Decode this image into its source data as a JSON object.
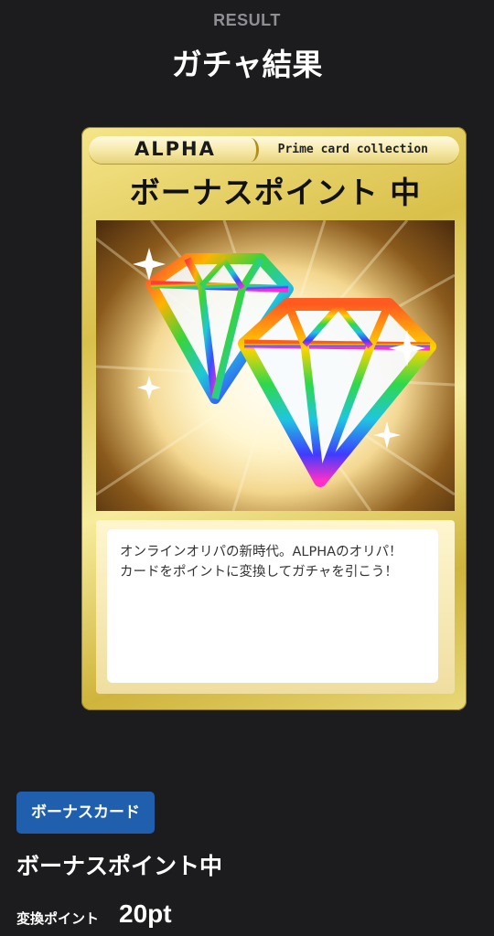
{
  "header": {
    "eyebrow": "RESULT",
    "title": "ガチャ結果"
  },
  "card": {
    "brand": "ALPHA",
    "collection": "Prime card collection",
    "name": "ボーナスポイント 中",
    "description_line1": "オンラインオリパの新時代。ALPHAのオリパ！",
    "description_line2": "カードをポイントに変換してガチャを引こう！",
    "art_icon": "diamond-icon"
  },
  "result": {
    "badge": "ボーナスカード",
    "item_name": "ボーナスポイント中",
    "points_label": "変換ポイント",
    "points_value": "20pt"
  },
  "colors": {
    "background": "#1c1c1e",
    "badge": "#1f5fae",
    "card_gold": "#d9c04a",
    "muted_text": "#8e8e93"
  }
}
